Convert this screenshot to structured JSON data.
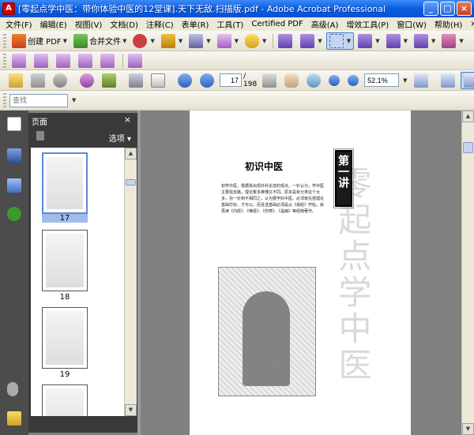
{
  "window": {
    "title": "[零起点学中医：带你体验中医的12堂课].天下无敌.扫描版.pdf - Adobe Acrobat Professional",
    "icon": "acrobat-icon"
  },
  "menu": [
    "文件(F)",
    "编辑(E)",
    "视图(V)",
    "文档(D)",
    "注释(C)",
    "表单(R)",
    "工具(T)",
    "Certified PDF",
    "高级(A)",
    "增效工具(P)",
    "窗口(W)",
    "帮助(H)"
  ],
  "toolbar1": {
    "create_pdf": "创建 PDF",
    "combine_files": "合并文件"
  },
  "nav": {
    "page_current": "17",
    "page_total": "/ 198",
    "zoom": "52.1%"
  },
  "find": {
    "placeholder": "查找"
  },
  "panel": {
    "title": "页面",
    "options": "选项",
    "thumbnails": [
      {
        "label": "17",
        "selected": true
      },
      {
        "label": "18",
        "selected": false
      },
      {
        "label": "19",
        "selected": false
      }
    ]
  },
  "document": {
    "chapter": "第一讲",
    "heading": "初识中医",
    "watermark": "零起点学中医",
    "paragraph": "初学中医，根据易出现外科论述的观点，一针认为，学中医主要需去路，理论繁多难懂又不同。原本是有分类这个大多，另一针到不相同之，认为要学好中医，必须家先把理论基础打好，才可以。而且选基础必须是从《易经》开始，就再读《内经》、《难经》、《伤寒》、《温病》等经典著作。"
  }
}
